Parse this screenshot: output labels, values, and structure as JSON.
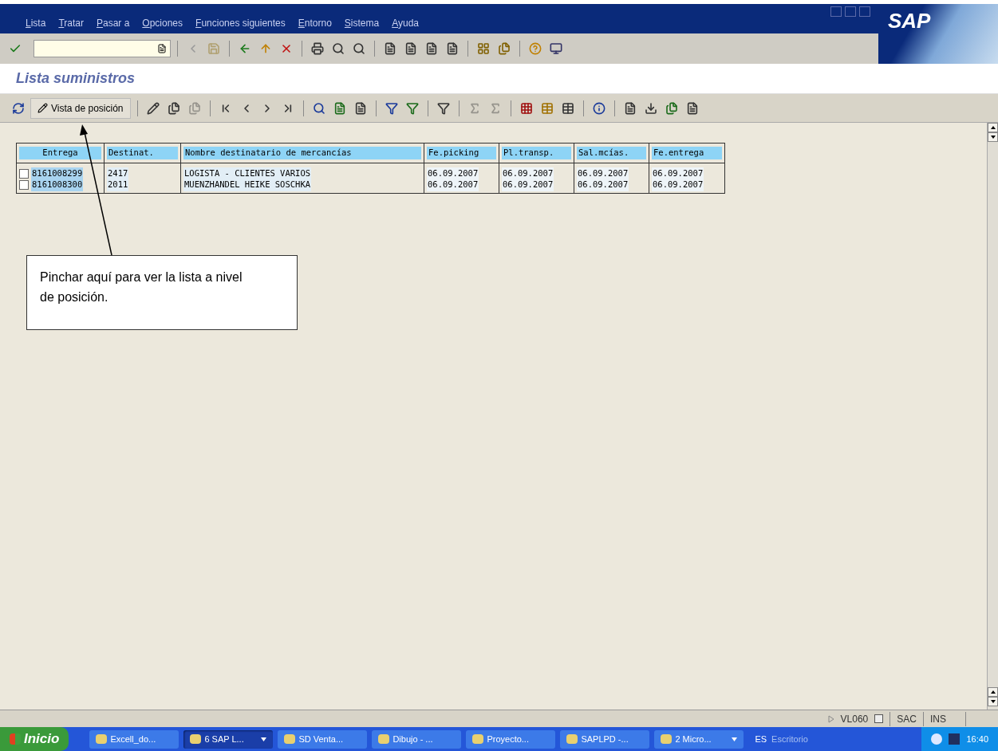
{
  "menu": [
    "Lista",
    "Tratar",
    "Pasar a",
    "Opciones",
    "Funciones siguientes",
    "Entorno",
    "Sistema",
    "Ayuda"
  ],
  "brand": "SAP",
  "title": "Lista suministros",
  "app_toolbar": {
    "button": "Vista de posición"
  },
  "table": {
    "columns": [
      "Entrega",
      "Destinat.",
      "Nombre destinatario de mercancías",
      "Fe.picking",
      "Pl.transp.",
      "Sal.mcías.",
      "Fe.entrega"
    ],
    "rows": [
      {
        "checked": false,
        "cells": [
          "8161008299",
          "2417",
          "LOGISTA - CLIENTES VARIOS",
          "06.09.2007",
          "06.09.2007",
          "06.09.2007",
          "06.09.2007"
        ]
      },
      {
        "checked": false,
        "cells": [
          "8161008300",
          "2011",
          "MUENZHANDEL HEIKE SOSCHKA",
          "06.09.2007",
          "06.09.2007",
          "06.09.2007",
          "06.09.2007"
        ]
      }
    ]
  },
  "callout": "Pinchar aquí para ver la lista a nivel de posición.",
  "status_bar": {
    "transaction": "VL060",
    "system": "SAC",
    "mode": "INS"
  },
  "taskbar": {
    "start": "Inicio",
    "items": [
      {
        "label": "Excell_do...",
        "selected": false,
        "grouped": false
      },
      {
        "label": "6 SAP L...",
        "selected": true,
        "grouped": true
      },
      {
        "label": "SD Venta...",
        "selected": false,
        "grouped": false
      },
      {
        "label": "Dibujo - ...",
        "selected": false,
        "grouped": false
      },
      {
        "label": "Proyecto...",
        "selected": false,
        "grouped": false
      },
      {
        "label": "SAPLPD -...",
        "selected": false,
        "grouped": false
      },
      {
        "label": "2 Micro...",
        "selected": false,
        "grouped": true
      }
    ],
    "language": "ES",
    "desktop": "Escritorio",
    "clock": "16:40"
  }
}
